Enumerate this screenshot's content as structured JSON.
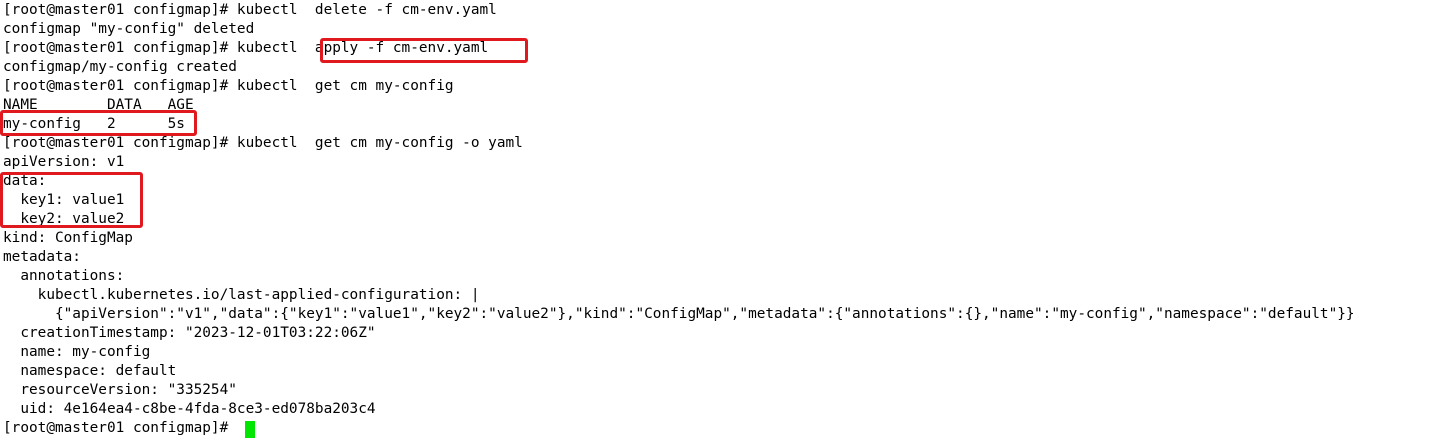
{
  "terminal": {
    "lines": [
      "[root@master01 configmap]# kubectl  delete -f cm-env.yaml",
      "configmap \"my-config\" deleted",
      "[root@master01 configmap]# kubectl  apply -f cm-env.yaml",
      "configmap/my-config created",
      "[root@master01 configmap]# kubectl  get cm my-config",
      "NAME        DATA   AGE",
      "my-config   2      5s",
      "[root@master01 configmap]# kubectl  get cm my-config -o yaml",
      "apiVersion: v1",
      "data:",
      "  key1: value1",
      "  key2: value2",
      "kind: ConfigMap",
      "metadata:",
      "  annotations:",
      "    kubectl.kubernetes.io/last-applied-configuration: |",
      "      {\"apiVersion\":\"v1\",\"data\":{\"key1\":\"value1\",\"key2\":\"value2\"},\"kind\":\"ConfigMap\",\"metadata\":{\"annotations\":{},\"name\":\"my-config\",\"namespace\":\"default\"}}",
      "  creationTimestamp: \"2023-12-01T03:22:06Z\"",
      "  name: my-config",
      "  namespace: default",
      "  resourceVersion: \"335254\"",
      "  uid: 4e164ea4-c8be-4fda-8ce3-ed078ba203c4",
      "[root@master01 configmap]# "
    ]
  },
  "colors": {
    "background": "#ffffff",
    "text": "#000000",
    "highlight": "#e0191f",
    "cursor": "#00e600"
  }
}
